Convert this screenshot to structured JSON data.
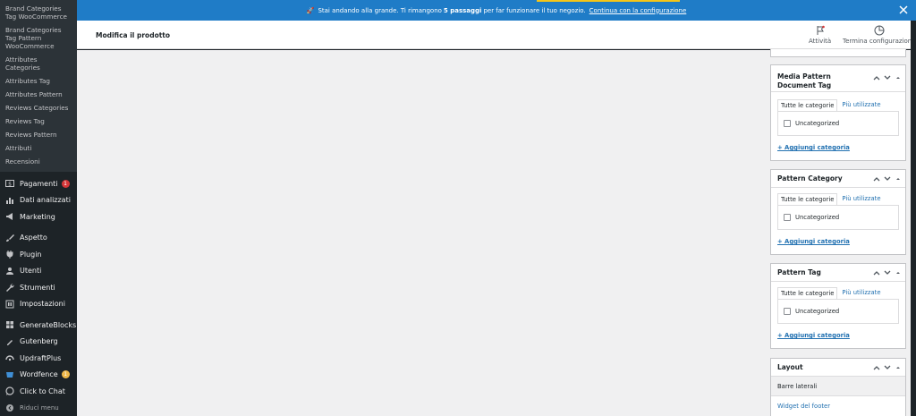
{
  "sidebar": {
    "submenu": [
      {
        "label": "Brand Categories Tag WooCommerce"
      },
      {
        "label": "Brand Categories Tag Pattern WooCommerce"
      },
      {
        "label": "Attributes Categories"
      },
      {
        "label": "Attributes Tag"
      },
      {
        "label": "Attributes Pattern"
      },
      {
        "label": "Reviews Categories"
      },
      {
        "label": "Reviews Tag"
      },
      {
        "label": "Reviews Pattern"
      },
      {
        "label": "Attributi"
      },
      {
        "label": "Recensioni"
      }
    ],
    "menu": [
      {
        "label": "Pagamenti",
        "icon": "dollar-icon",
        "badge": "1",
        "badge_color": "#d63638"
      },
      {
        "label": "Dati analizzati",
        "icon": "bar-chart-icon"
      },
      {
        "label": "Marketing",
        "icon": "megaphone-icon"
      },
      {
        "label": "Aspetto",
        "icon": "paintbrush-icon"
      },
      {
        "label": "Plugin",
        "icon": "plugin-icon"
      },
      {
        "label": "Utenti",
        "icon": "users-icon"
      },
      {
        "label": "Strumenti",
        "icon": "wrench-icon"
      },
      {
        "label": "Impostazioni",
        "icon": "settings-icon"
      },
      {
        "label": "GenerateBlocks",
        "icon": "blocks-icon"
      },
      {
        "label": "Gutenberg",
        "icon": "gutenberg-icon"
      },
      {
        "label": "UpdraftPlus",
        "icon": "updraft-icon"
      },
      {
        "label": "Wordfence",
        "icon": "wordfence-icon",
        "badge": "1",
        "badge_color": "#f0b849"
      },
      {
        "label": "Click to Chat",
        "icon": "whatsapp-icon"
      },
      {
        "label": "Riduci menu",
        "icon": "collapse-icon"
      }
    ]
  },
  "notice": {
    "emoji": "🚀",
    "text_pre": "Stai andando alla grande. Ti rimangono ",
    "text_bold": "5 passaggi",
    "text_post": " per far funzionare il tuo negozio.",
    "link": "Continua con la configurazione",
    "bg_color": "#1f7cc7"
  },
  "header": {
    "title": "Modifica il prodotto",
    "activity_label": "Attività",
    "finish_label": "Termina configurazione"
  },
  "boxes": [
    {
      "title": "Media Pattern Document Tag",
      "tab_all": "Tutte le categorie",
      "tab_popular": "Più utilizzate",
      "category": "Uncategorized",
      "add_label": "+ Aggiungi categoria"
    },
    {
      "title": "Pattern Category",
      "tab_all": "Tutte le categorie",
      "tab_popular": "Più utilizzate",
      "category": "Uncategorized",
      "add_label": "+ Aggiungi categoria"
    },
    {
      "title": "Pattern Tag",
      "tab_all": "Tutte le categorie",
      "tab_popular": "Più utilizzate",
      "category": "Uncategorized",
      "add_label": "+ Aggiungi categoria"
    }
  ],
  "layout_box": {
    "title": "Layout",
    "row1": "Barre laterali",
    "row2": "Widget del footer"
  }
}
